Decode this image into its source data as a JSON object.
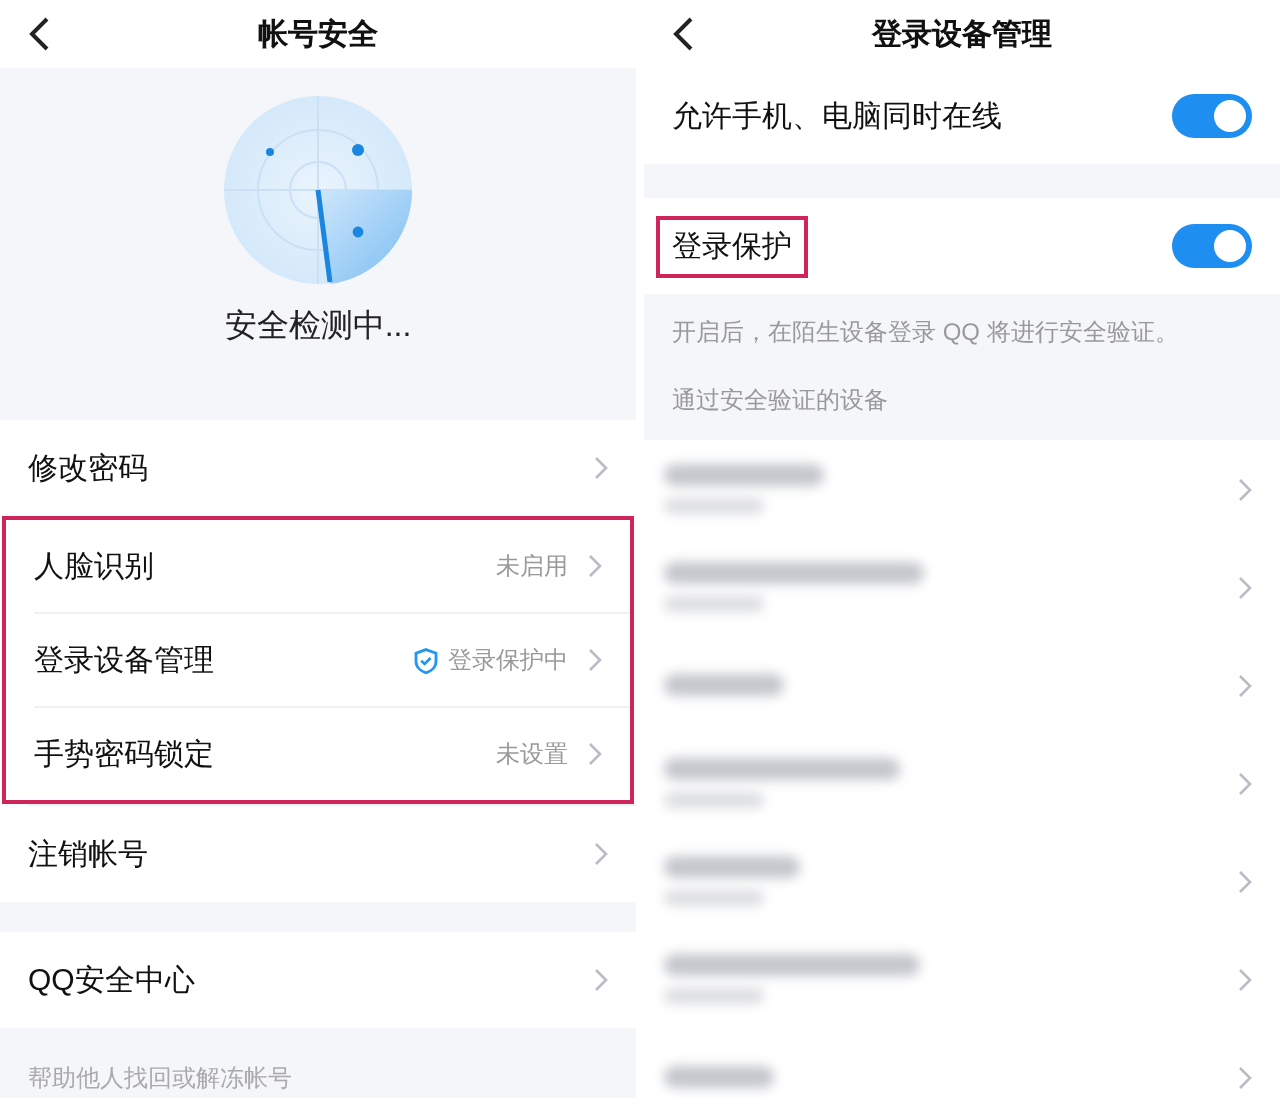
{
  "left": {
    "title": "帐号安全",
    "scan_status": "安全检测中...",
    "sections": [
      {
        "items": [
          {
            "label": "修改密码",
            "kind": "plain",
            "highlighted": false
          },
          {
            "label": "人脸识别",
            "value": "未启用",
            "kind": "plain",
            "highlighted": true
          },
          {
            "label": "登录设备管理",
            "value": "登录保护中",
            "kind": "protected",
            "highlighted": true
          },
          {
            "label": "手势密码锁定",
            "value": "未设置",
            "kind": "plain",
            "highlighted": true
          },
          {
            "label": "注销帐号",
            "kind": "plain",
            "highlighted": false
          }
        ]
      },
      {
        "items": [
          {
            "label": "QQ安全中心",
            "kind": "plain",
            "highlighted": false
          }
        ]
      }
    ],
    "footer_link": "帮助他人找回或解冻帐号"
  },
  "right": {
    "title": "登录设备管理",
    "switches": [
      {
        "label": "允许手机、电脑同时在线",
        "on": true,
        "highlighted": false
      },
      {
        "label": "登录保护",
        "on": true,
        "highlighted": true
      }
    ],
    "note": "开启后，在陌生设备登录 QQ 将进行安全验证。",
    "section_title": "通过安全验证的设备",
    "devices": [
      {
        "kind": "two-line"
      },
      {
        "kind": "two-line"
      },
      {
        "kind": "one-line"
      },
      {
        "kind": "two-line"
      },
      {
        "kind": "two-line"
      },
      {
        "kind": "two-line"
      },
      {
        "kind": "one-line"
      }
    ]
  }
}
